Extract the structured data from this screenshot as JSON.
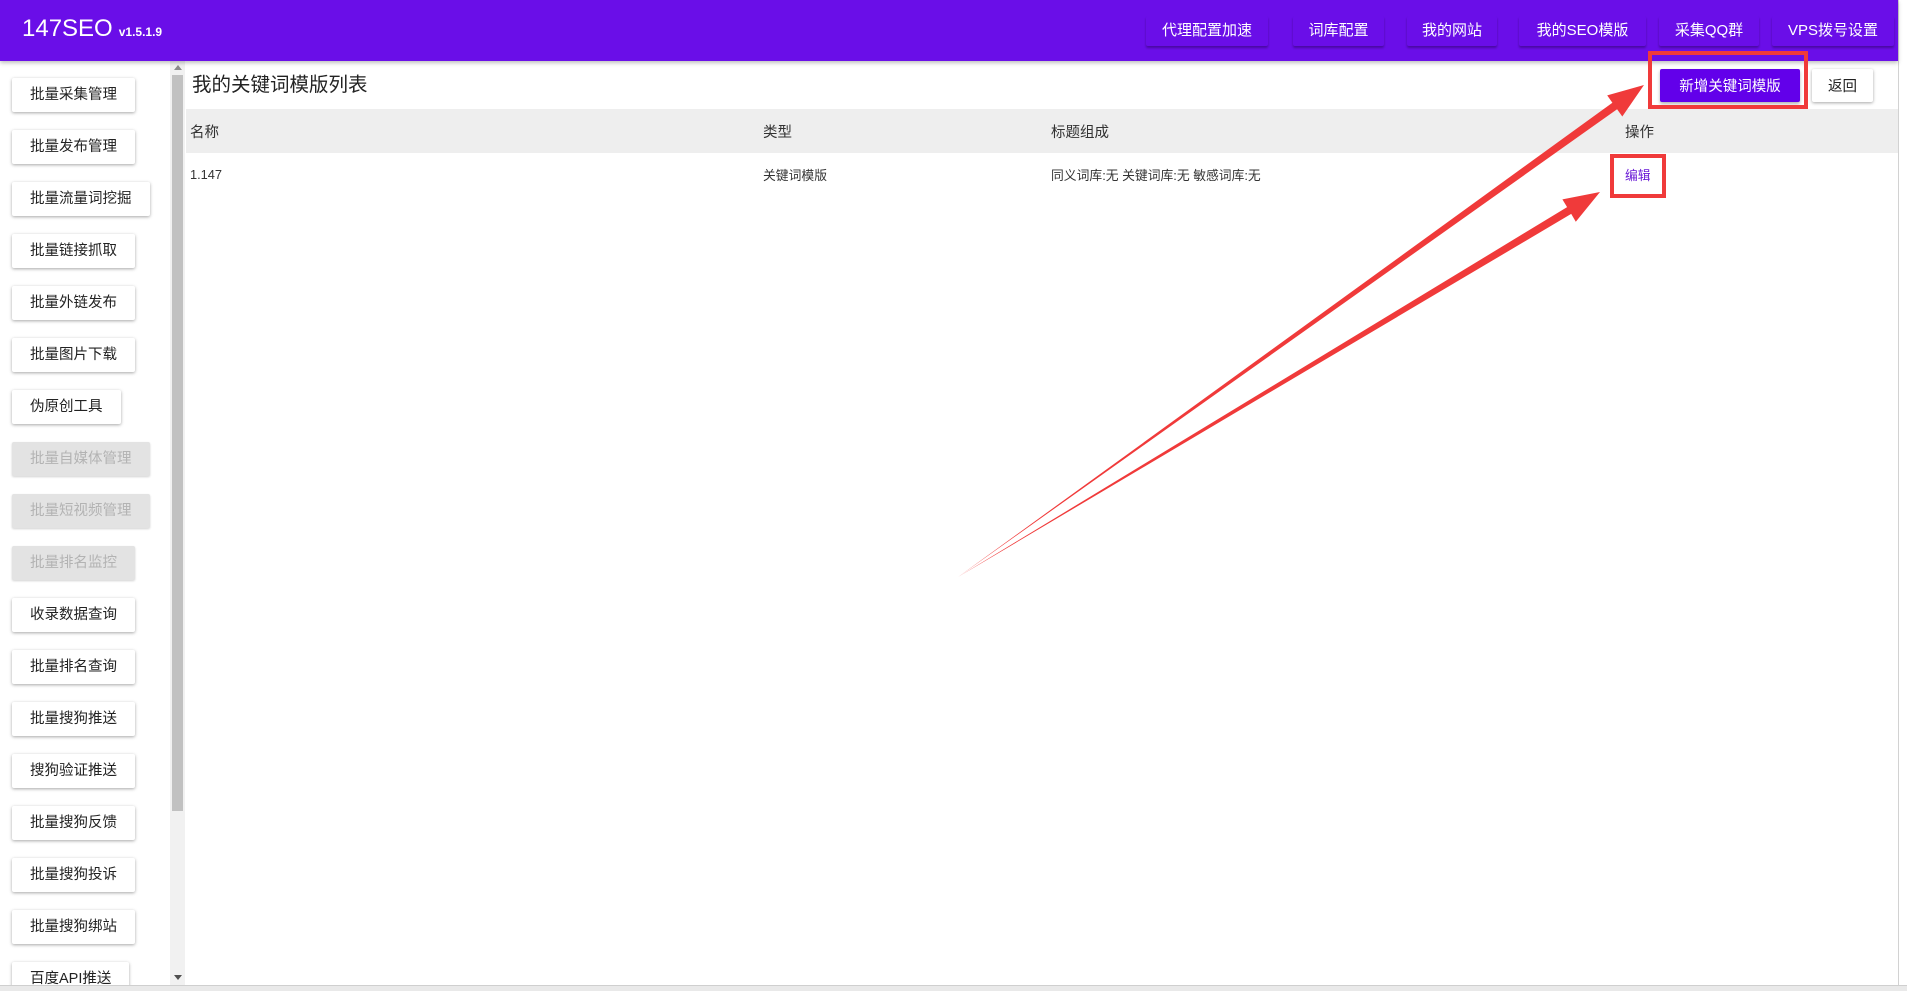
{
  "app": {
    "title": "147SEO",
    "version": "v1.5.1.9"
  },
  "nav": [
    {
      "label": "代理配置加速"
    },
    {
      "label": "词库配置"
    },
    {
      "label": "我的网站"
    },
    {
      "label": "我的SEO模版"
    },
    {
      "label": "采集QQ群"
    },
    {
      "label": "VPS拨号设置"
    }
  ],
  "sidebar": {
    "items": [
      {
        "label": "批量采集管理",
        "disabled": false
      },
      {
        "label": "批量发布管理",
        "disabled": false
      },
      {
        "label": "批量流量词挖掘",
        "disabled": false
      },
      {
        "label": "批量链接抓取",
        "disabled": false
      },
      {
        "label": "批量外链发布",
        "disabled": false
      },
      {
        "label": "批量图片下载",
        "disabled": false
      },
      {
        "label": "伪原创工具",
        "disabled": false
      },
      {
        "label": "批量自媒体管理",
        "disabled": true
      },
      {
        "label": "批量短视频管理",
        "disabled": true
      },
      {
        "label": "批量排名监控",
        "disabled": true
      },
      {
        "label": "收录数据查询",
        "disabled": false
      },
      {
        "label": "批量排名查询",
        "disabled": false
      },
      {
        "label": "批量搜狗推送",
        "disabled": false
      },
      {
        "label": "搜狗验证推送",
        "disabled": false
      },
      {
        "label": "批量搜狗反馈",
        "disabled": false
      },
      {
        "label": "批量搜狗投诉",
        "disabled": false
      },
      {
        "label": "批量搜狗绑站",
        "disabled": false
      },
      {
        "label": "百度API推送",
        "disabled": false
      }
    ]
  },
  "page": {
    "title": "我的关键词模版列表",
    "add_button": "新增关键词模版",
    "back_button": "返回"
  },
  "table": {
    "columns": [
      "名称",
      "类型",
      "标题组成",
      "操作"
    ],
    "rows": [
      {
        "name": "1.147",
        "type": "关键词模版",
        "title_composition": "同义词库:无 关键词库:无 敏感词库:无",
        "action": "编辑"
      }
    ]
  },
  "colors": {
    "header": "#6a0ee8",
    "accent": "#6200ea",
    "link": "#6a1bd6",
    "annotation": "#f03a3a",
    "disabled_bg": "#e3e3e3"
  }
}
